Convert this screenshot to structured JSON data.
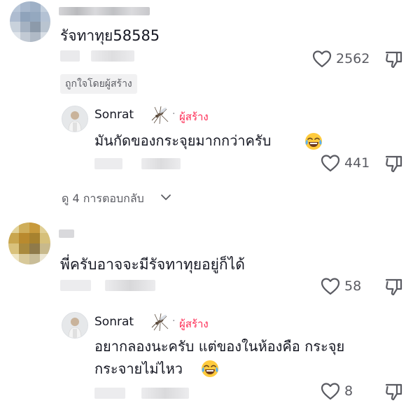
{
  "comments": [
    {
      "text": "รัจทาทุย58585",
      "likes": "2562",
      "liked_by_creator": "ถูกใจโดยผู้สร้าง",
      "view_replies": "ดู 4 การตอบกลับ",
      "reply": {
        "author": "Sonrat",
        "creator_label": "ผู้สร้าง",
        "text": "มันกัดของกระจุยมากกว่าครับ",
        "likes": "441"
      }
    },
    {
      "text": "พี่ครับอาจจะมีรัจทาทุยอยู่ก็ได้",
      "likes": "58",
      "reply": {
        "author": "Sonrat",
        "creator_label": "ผู้สร้าง",
        "text_line1": "อยากลองนะครับ แต่ของในห้องคือ กระจุย",
        "text_line2": "กระจายไม่ไหว",
        "likes": "8"
      }
    }
  ],
  "icons": {
    "like": "heart-outline-icon",
    "dislike": "thumbs-down-icon",
    "mosquito": "mosquito-emoji",
    "laugh": "face-with-tears-of-joy-emoji",
    "chevron": "chevron-down-icon"
  },
  "colors": {
    "creator": "#fe2c55",
    "text": "#161823",
    "muted": "#5a5b62"
  }
}
